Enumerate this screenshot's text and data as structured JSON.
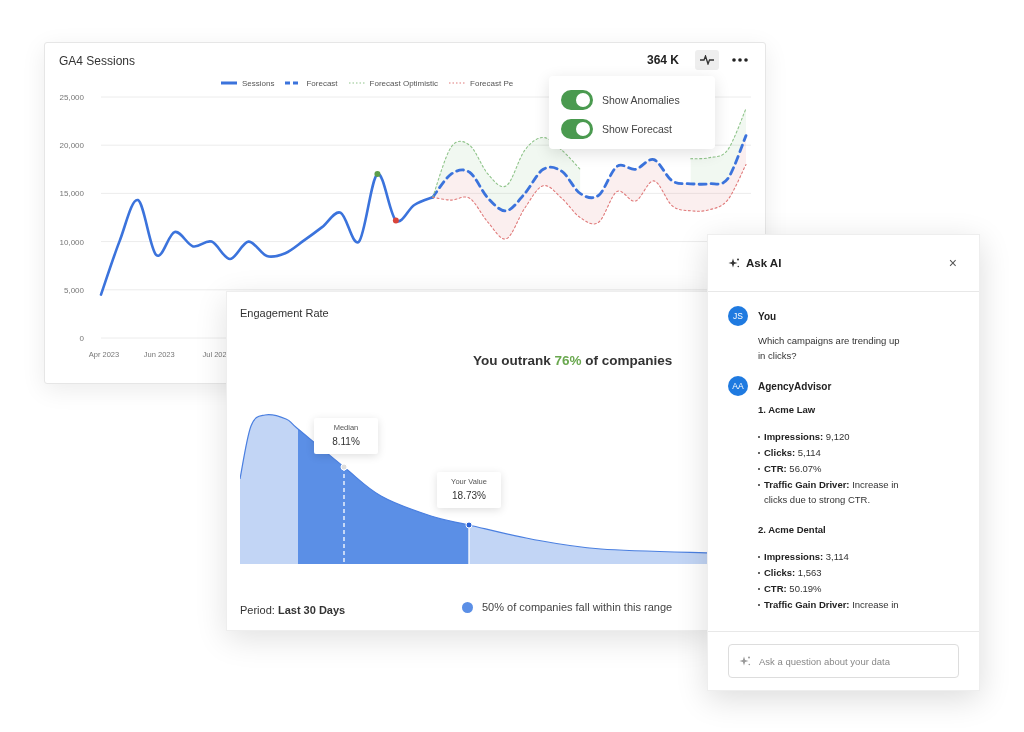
{
  "sessions_card": {
    "title": "GA4 Sessions",
    "total": "364 K",
    "anomalies": [
      {
        "color": "#5b9e4b"
      },
      {
        "color": "#d9453b"
      }
    ],
    "chart_data": {
      "type": "line",
      "categories": [
        "Apr 2023",
        null,
        null,
        "Jun 2023",
        null,
        null,
        "Jul 202",
        null,
        null,
        null,
        null,
        null,
        null,
        null,
        null,
        null,
        null,
        null,
        null,
        null,
        null,
        null,
        null,
        null,
        null,
        null,
        null,
        null,
        null,
        null,
        null,
        null,
        null,
        null,
        null,
        null
      ],
      "ylim": [
        0,
        25000
      ],
      "grid": true,
      "yticks": [
        0,
        {
          "value": 5000,
          "label": "5,000"
        },
        {
          "value": 10000,
          "label": "10,000"
        },
        {
          "value": 15000,
          "label": "15,000"
        },
        {
          "value": 20000,
          "label": "20,000"
        },
        {
          "value": 25000,
          "label": "25,000"
        }
      ],
      "series": [
        {
          "name": "Sessions",
          "color": "#3b73dc",
          "line_style": "solid",
          "values": [
            4500,
            10000,
            14300,
            8600,
            11000,
            9500,
            10000,
            8200,
            10000,
            8500,
            8800,
            10100,
            11500,
            13000,
            10000,
            17000,
            12200,
            13800,
            14600,
            null,
            null,
            null,
            null,
            null,
            null,
            null,
            null,
            null,
            null,
            null,
            null,
            null,
            null,
            null,
            null,
            null
          ]
        },
        {
          "name": "Forecast",
          "color": "#3b73dc",
          "line_style": "dashed",
          "values": [
            null,
            null,
            null,
            null,
            null,
            null,
            null,
            null,
            null,
            null,
            null,
            null,
            null,
            null,
            null,
            null,
            null,
            null,
            14600,
            17000,
            17200,
            14500,
            13200,
            15000,
            17500,
            17300,
            15000,
            14800,
            17800,
            17500,
            18500,
            16300,
            16000,
            16000,
            16500,
            21000
          ]
        },
        {
          "name": "Forecast Optimistic",
          "color": "#8fc48a",
          "line_style": "dotted",
          "values": [
            null,
            null,
            null,
            null,
            null,
            null,
            null,
            null,
            null,
            null,
            null,
            null,
            null,
            null,
            null,
            null,
            null,
            null,
            14600,
            19800,
            20000,
            17000,
            15800,
            19500,
            20800,
            19500,
            17500,
            null,
            null,
            null,
            null,
            null,
            18600,
            18700,
            19500,
            23800
          ]
        },
        {
          "name": "Forecast Pe",
          "color": "#e07a7a",
          "line_style": "dotted",
          "values": [
            null,
            null,
            null,
            null,
            null,
            null,
            null,
            null,
            null,
            null,
            null,
            null,
            null,
            null,
            null,
            null,
            null,
            null,
            14600,
            14300,
            14500,
            12000,
            10300,
            13500,
            15800,
            14500,
            12500,
            12000,
            15200,
            14200,
            16300,
            13700,
            13200,
            13300,
            14300,
            18000
          ]
        }
      ]
    }
  },
  "toggle_menu": {
    "items": [
      {
        "label": "Show Anomalies",
        "on": true
      },
      {
        "label": "Show Forecast",
        "on": true
      }
    ]
  },
  "engagement_card": {
    "title": "Engagement Rate",
    "headline": "You outrank **76%** of companies",
    "markers": [
      {
        "kind": "median",
        "label": "Median",
        "value": "8.11%"
      },
      {
        "kind": "you",
        "label": "Your Value",
        "value": "18.73%"
      }
    ],
    "period": "Period: **Last 30 Days**",
    "range_note": "50% of companies fall within this range"
  },
  "ask_ai": {
    "title": "Ask AI",
    "close": "×",
    "messages": [
      {
        "avatar": "JS",
        "author": "You",
        "text": "Which campaigns are trending up in clicks?"
      },
      {
        "avatar": "AA",
        "author": "AgencyAdvisor",
        "sections": [
          {
            "heading": "1. Acme Law",
            "items": [
              "**Impressions:** 9,120",
              "**Clicks:** 5,114",
              "**CTR:** 56.07%",
              "**Traffic Gain Driver:** Increase in clicks due to strong CTR."
            ]
          },
          {
            "heading": "2. Acme Dental",
            "items": [
              "**Impressions:** 3,114",
              "**Clicks:** 1,563",
              "**CTR:** 50.19%",
              "**Traffic Gain Driver:** Increase in"
            ]
          }
        ]
      }
    ],
    "placeholder": "Ask a question about your data"
  }
}
